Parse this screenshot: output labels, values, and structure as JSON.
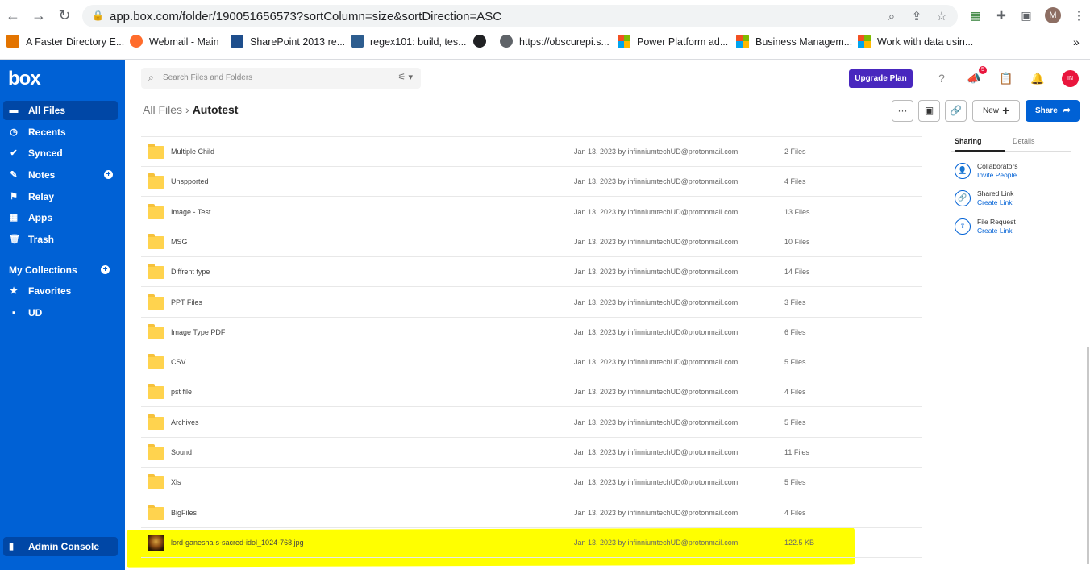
{
  "browser": {
    "url": "app.box.com/folder/190051656573?sortColumn=size&sortDirection=ASC",
    "profile_initial": "M",
    "bookmarks": [
      {
        "label": "A Faster Directory E...",
        "color": "#e37400"
      },
      {
        "label": "Webmail - Main",
        "color": "#ff6c2c"
      },
      {
        "label": "SharePoint 2013 re...",
        "color": "#1e4e8c"
      },
      {
        "label": "regex101: build, tes...",
        "color": "#2d5d8f"
      },
      {
        "label": "",
        "color": "#202124"
      },
      {
        "label": "https://obscurepi.s...",
        "color": "#5f6368"
      },
      {
        "label": "Power Platform ad...",
        "color": "ms"
      },
      {
        "label": "Business Managem...",
        "color": "ms"
      },
      {
        "label": "Work with data usin...",
        "color": "ms"
      }
    ],
    "more": "»"
  },
  "sidebar": {
    "logo": "box",
    "items": [
      {
        "label": "All Files",
        "icon": "▬"
      },
      {
        "label": "Recents",
        "icon": "◷"
      },
      {
        "label": "Synced",
        "icon": "✔"
      },
      {
        "label": "Notes",
        "icon": "✎"
      },
      {
        "label": "Relay",
        "icon": "⚑"
      },
      {
        "label": "Apps",
        "icon": "▦"
      },
      {
        "label": "Trash",
        "icon": "🗑"
      }
    ],
    "collections_label": "My Collections",
    "collections": [
      {
        "label": "Favorites",
        "icon": "★"
      },
      {
        "label": "UD",
        "icon": "▪"
      }
    ],
    "admin_label": "Admin Console",
    "plus": "+"
  },
  "header": {
    "search_placeholder": "Search Files and Folders",
    "upgrade_label": "Upgrade Plan",
    "notification_count": "5",
    "avatar_initials": "IN",
    "breadcrumb_root": "All Files",
    "breadcrumb_sep": "›",
    "breadcrumb_current": "Autotest",
    "new_label": "New",
    "new_plus": "+",
    "share_label": "Share",
    "more_label": "···"
  },
  "files": [
    {
      "name": "Multiple Child",
      "modified": "Jan 13, 2023 by infinniumtechUD@protonmail.com",
      "size": "2 Files",
      "type": "folder"
    },
    {
      "name": "Unspported",
      "modified": "Jan 13, 2023 by infinniumtechUD@protonmail.com",
      "size": "4 Files",
      "type": "folder"
    },
    {
      "name": "Image - Test",
      "modified": "Jan 13, 2023 by infinniumtechUD@protonmail.com",
      "size": "13 Files",
      "type": "folder"
    },
    {
      "name": "MSG",
      "modified": "Jan 13, 2023 by infinniumtechUD@protonmail.com",
      "size": "10 Files",
      "type": "folder"
    },
    {
      "name": "Diffrent type",
      "modified": "Jan 13, 2023 by infinniumtechUD@protonmail.com",
      "size": "14 Files",
      "type": "folder"
    },
    {
      "name": "PPT Files",
      "modified": "Jan 13, 2023 by infinniumtechUD@protonmail.com",
      "size": "3 Files",
      "type": "folder"
    },
    {
      "name": "Image Type PDF",
      "modified": "Jan 13, 2023 by infinniumtechUD@protonmail.com",
      "size": "6 Files",
      "type": "folder"
    },
    {
      "name": "CSV",
      "modified": "Jan 13, 2023 by infinniumtechUD@protonmail.com",
      "size": "5 Files",
      "type": "folder"
    },
    {
      "name": "pst file",
      "modified": "Jan 13, 2023 by infinniumtechUD@protonmail.com",
      "size": "4 Files",
      "type": "folder"
    },
    {
      "name": "Archives",
      "modified": "Jan 13, 2023 by infinniumtechUD@protonmail.com",
      "size": "5 Files",
      "type": "folder"
    },
    {
      "name": "Sound",
      "modified": "Jan 13, 2023 by infinniumtechUD@protonmail.com",
      "size": "11 Files",
      "type": "folder"
    },
    {
      "name": "Xls",
      "modified": "Jan 13, 2023 by infinniumtechUD@protonmail.com",
      "size": "5 Files",
      "type": "folder"
    },
    {
      "name": "BigFiles",
      "modified": "Jan 13, 2023 by infinniumtechUD@protonmail.com",
      "size": "4 Files",
      "type": "folder"
    },
    {
      "name": "lord-ganesha-s-sacred-idol_1024-768.jpg",
      "modified": "Jan 13, 2023 by infinniumtechUD@protonmail.com",
      "size": "122.5 KB",
      "type": "image"
    }
  ],
  "panel": {
    "tab_sharing": "Sharing",
    "tab_details": "Details",
    "items": [
      {
        "title": "Collaborators",
        "link": "Invite People",
        "icon": "👤"
      },
      {
        "title": "Shared Link",
        "link": "Create Link",
        "icon": "🔗"
      },
      {
        "title": "File Request",
        "link": "Create Link",
        "icon": "⇪"
      }
    ]
  },
  "colors": {
    "brand": "#0061d5",
    "upgrade": "#4827be",
    "highlight": "#ffff00",
    "folder": "#ffd34e"
  }
}
